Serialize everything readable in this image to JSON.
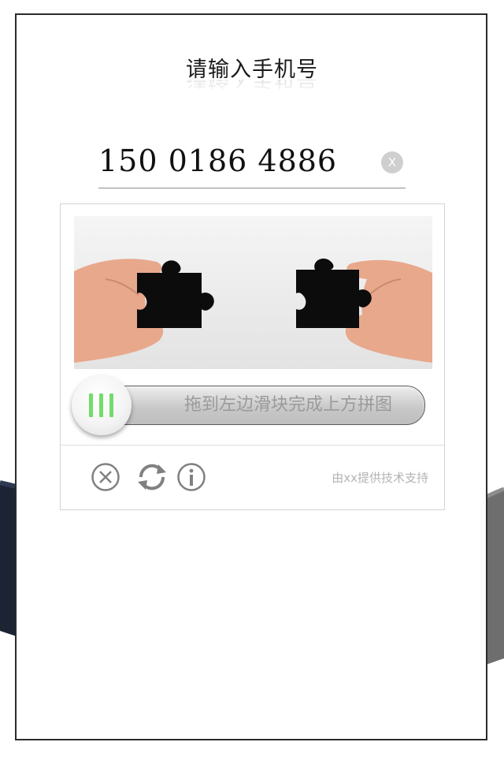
{
  "header": {
    "title": "请输入手机号"
  },
  "phone": {
    "value": "150 0186 4886",
    "clear_icon_label": "X"
  },
  "captcha": {
    "slider_hint": "拖到左边滑块完成上方拼图",
    "credit": "由xx提供技术支持",
    "icons": [
      "close-circle-icon",
      "refresh-icon",
      "info-icon",
      "grip-icon"
    ]
  },
  "colors": {
    "grip": "#74dc6a",
    "frame": "#2b2b2b",
    "hint_text": "#9a9a9a"
  }
}
